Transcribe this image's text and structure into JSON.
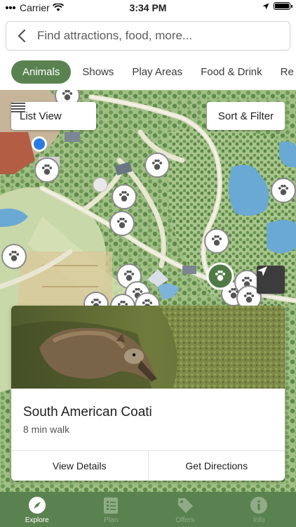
{
  "status": {
    "carrier": "Carrier",
    "time": "3:34 PM"
  },
  "search": {
    "placeholder": "Find attractions, food, more..."
  },
  "tabs": [
    {
      "label": "Animals",
      "active": true
    },
    {
      "label": "Shows"
    },
    {
      "label": "Play Areas"
    },
    {
      "label": "Food & Drink"
    },
    {
      "label": "Re"
    }
  ],
  "map": {
    "list_view_label": "List View",
    "sort_filter_label": "Sort & Filter",
    "pin_icon": "paw-icon",
    "colors": {
      "pin_selected": "#4f7a45",
      "user_dot": "#2a7be4",
      "accent": "#5a8250"
    }
  },
  "card": {
    "title": "South American Coati",
    "subtitle": "8 min walk",
    "view_details": "View Details",
    "get_directions": "Get Directions"
  },
  "nav": [
    {
      "label": "Explore",
      "icon": "compass-icon",
      "active": true
    },
    {
      "label": "Plan",
      "icon": "checklist-icon"
    },
    {
      "label": "Offers",
      "icon": "tag-icon"
    },
    {
      "label": "Info",
      "icon": "info-icon"
    }
  ]
}
